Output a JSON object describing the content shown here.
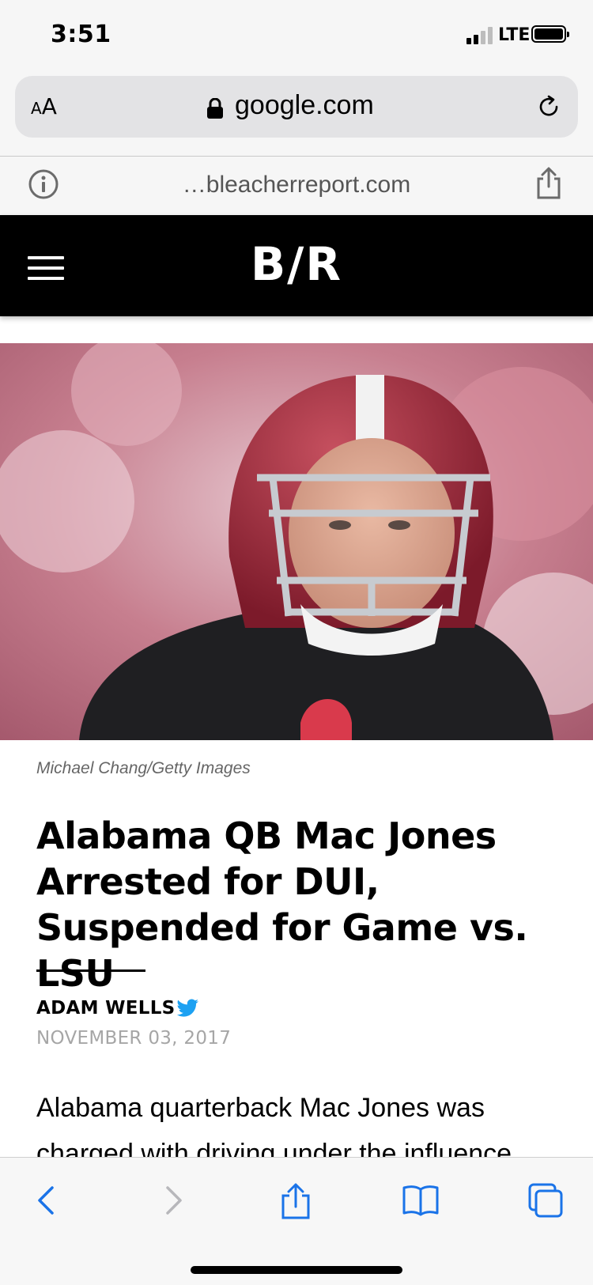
{
  "status_bar": {
    "time": "3:51",
    "network": "LTE"
  },
  "browser": {
    "text_size_label_small": "A",
    "text_size_label_large": "A",
    "url": "google.com",
    "amp_source": "…bleacherreport.com"
  },
  "site": {
    "logo": "B/R"
  },
  "article": {
    "photo_credit": "Michael Chang/Getty Images",
    "headline": "Alabama QB Mac Jones Arrested for DUI, Suspended for Game vs. LSU",
    "author": "ADAM WELLS",
    "date": "NOVEMBER 03, 2017",
    "body_first_line": "Alabama quarterback Mac Jones was",
    "body_second_line": "charged with driving under the influence"
  },
  "colors": {
    "twitter_blue": "#1da1f2",
    "toolbar_blue": "#1a73e8",
    "header_black": "#000000"
  }
}
